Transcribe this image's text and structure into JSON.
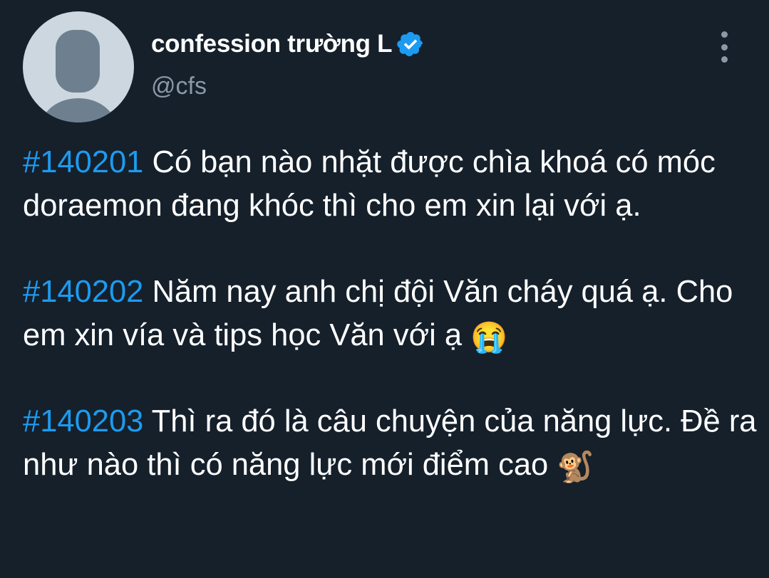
{
  "user": {
    "display_name": "confession trường L",
    "handle": "@cfs",
    "verified": true,
    "avatar": "default-avatar-placeholder"
  },
  "menu": {
    "icon": "more-vertical-icon"
  },
  "colors": {
    "background": "#15202b",
    "text": "#ffffff",
    "secondary_text": "#8b98a5",
    "hashtag": "#1d9bf0",
    "verified_badge": "#1d9bf0"
  },
  "tweet": {
    "paragraphs": [
      {
        "hashtag": "#140201",
        "text": " Có bạn nào nhặt được chìa khoá có móc doraemon đang khóc thì cho em xin lại với ạ.",
        "emoji": ""
      },
      {
        "hashtag": "#140202",
        "text": " Năm nay anh chị đội Văn cháy quá ạ. Cho em xin vía và tips học Văn với ạ ",
        "emoji": "😭"
      },
      {
        "hashtag": "#140203",
        "text": " Thì ra đó là câu chuyện của năng lực. Đề ra như nào thì có năng lực mới điểm cao ",
        "emoji": "🐒"
      }
    ]
  }
}
